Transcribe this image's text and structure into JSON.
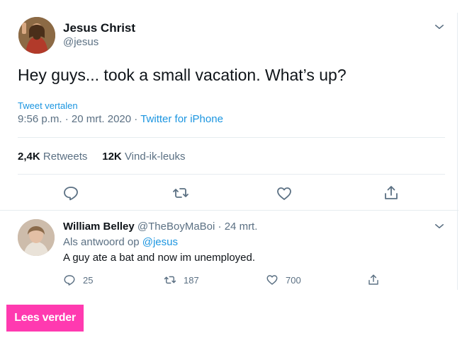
{
  "tweet": {
    "author_name": "Jesus Christ",
    "author_handle": "@jesus",
    "text": "Hey guys... took a small vacation. What’s up?",
    "translate_label": "Tweet vertalen",
    "time": "9:56 p.m.",
    "dot1": "·",
    "date": "20 mrt. 2020",
    "dot2": "·",
    "source": "Twitter for iPhone",
    "retweets_count": "2,4K",
    "retweets_label": "Retweets",
    "likes_count": "12K",
    "likes_label": "Vind-ik-leuks"
  },
  "reply": {
    "author_name": "William Belley",
    "author_handle": "@TheBoyMaBoi",
    "dot": "·",
    "date": "24 mrt.",
    "replying_prefix": "Als antwoord op",
    "replying_to": "@jesus",
    "text": "A guy ate a bat and now im unemployed.",
    "reply_count": "25",
    "retweet_count": "187",
    "like_count": "700"
  },
  "cta": {
    "label": "Lees verder"
  },
  "colors": {
    "accent": "#1b95e0",
    "cta": "#ff3ab0",
    "muted": "#5b7083"
  },
  "icons": [
    "chevron-down-icon",
    "reply-icon",
    "retweet-icon",
    "like-icon",
    "share-icon"
  ]
}
